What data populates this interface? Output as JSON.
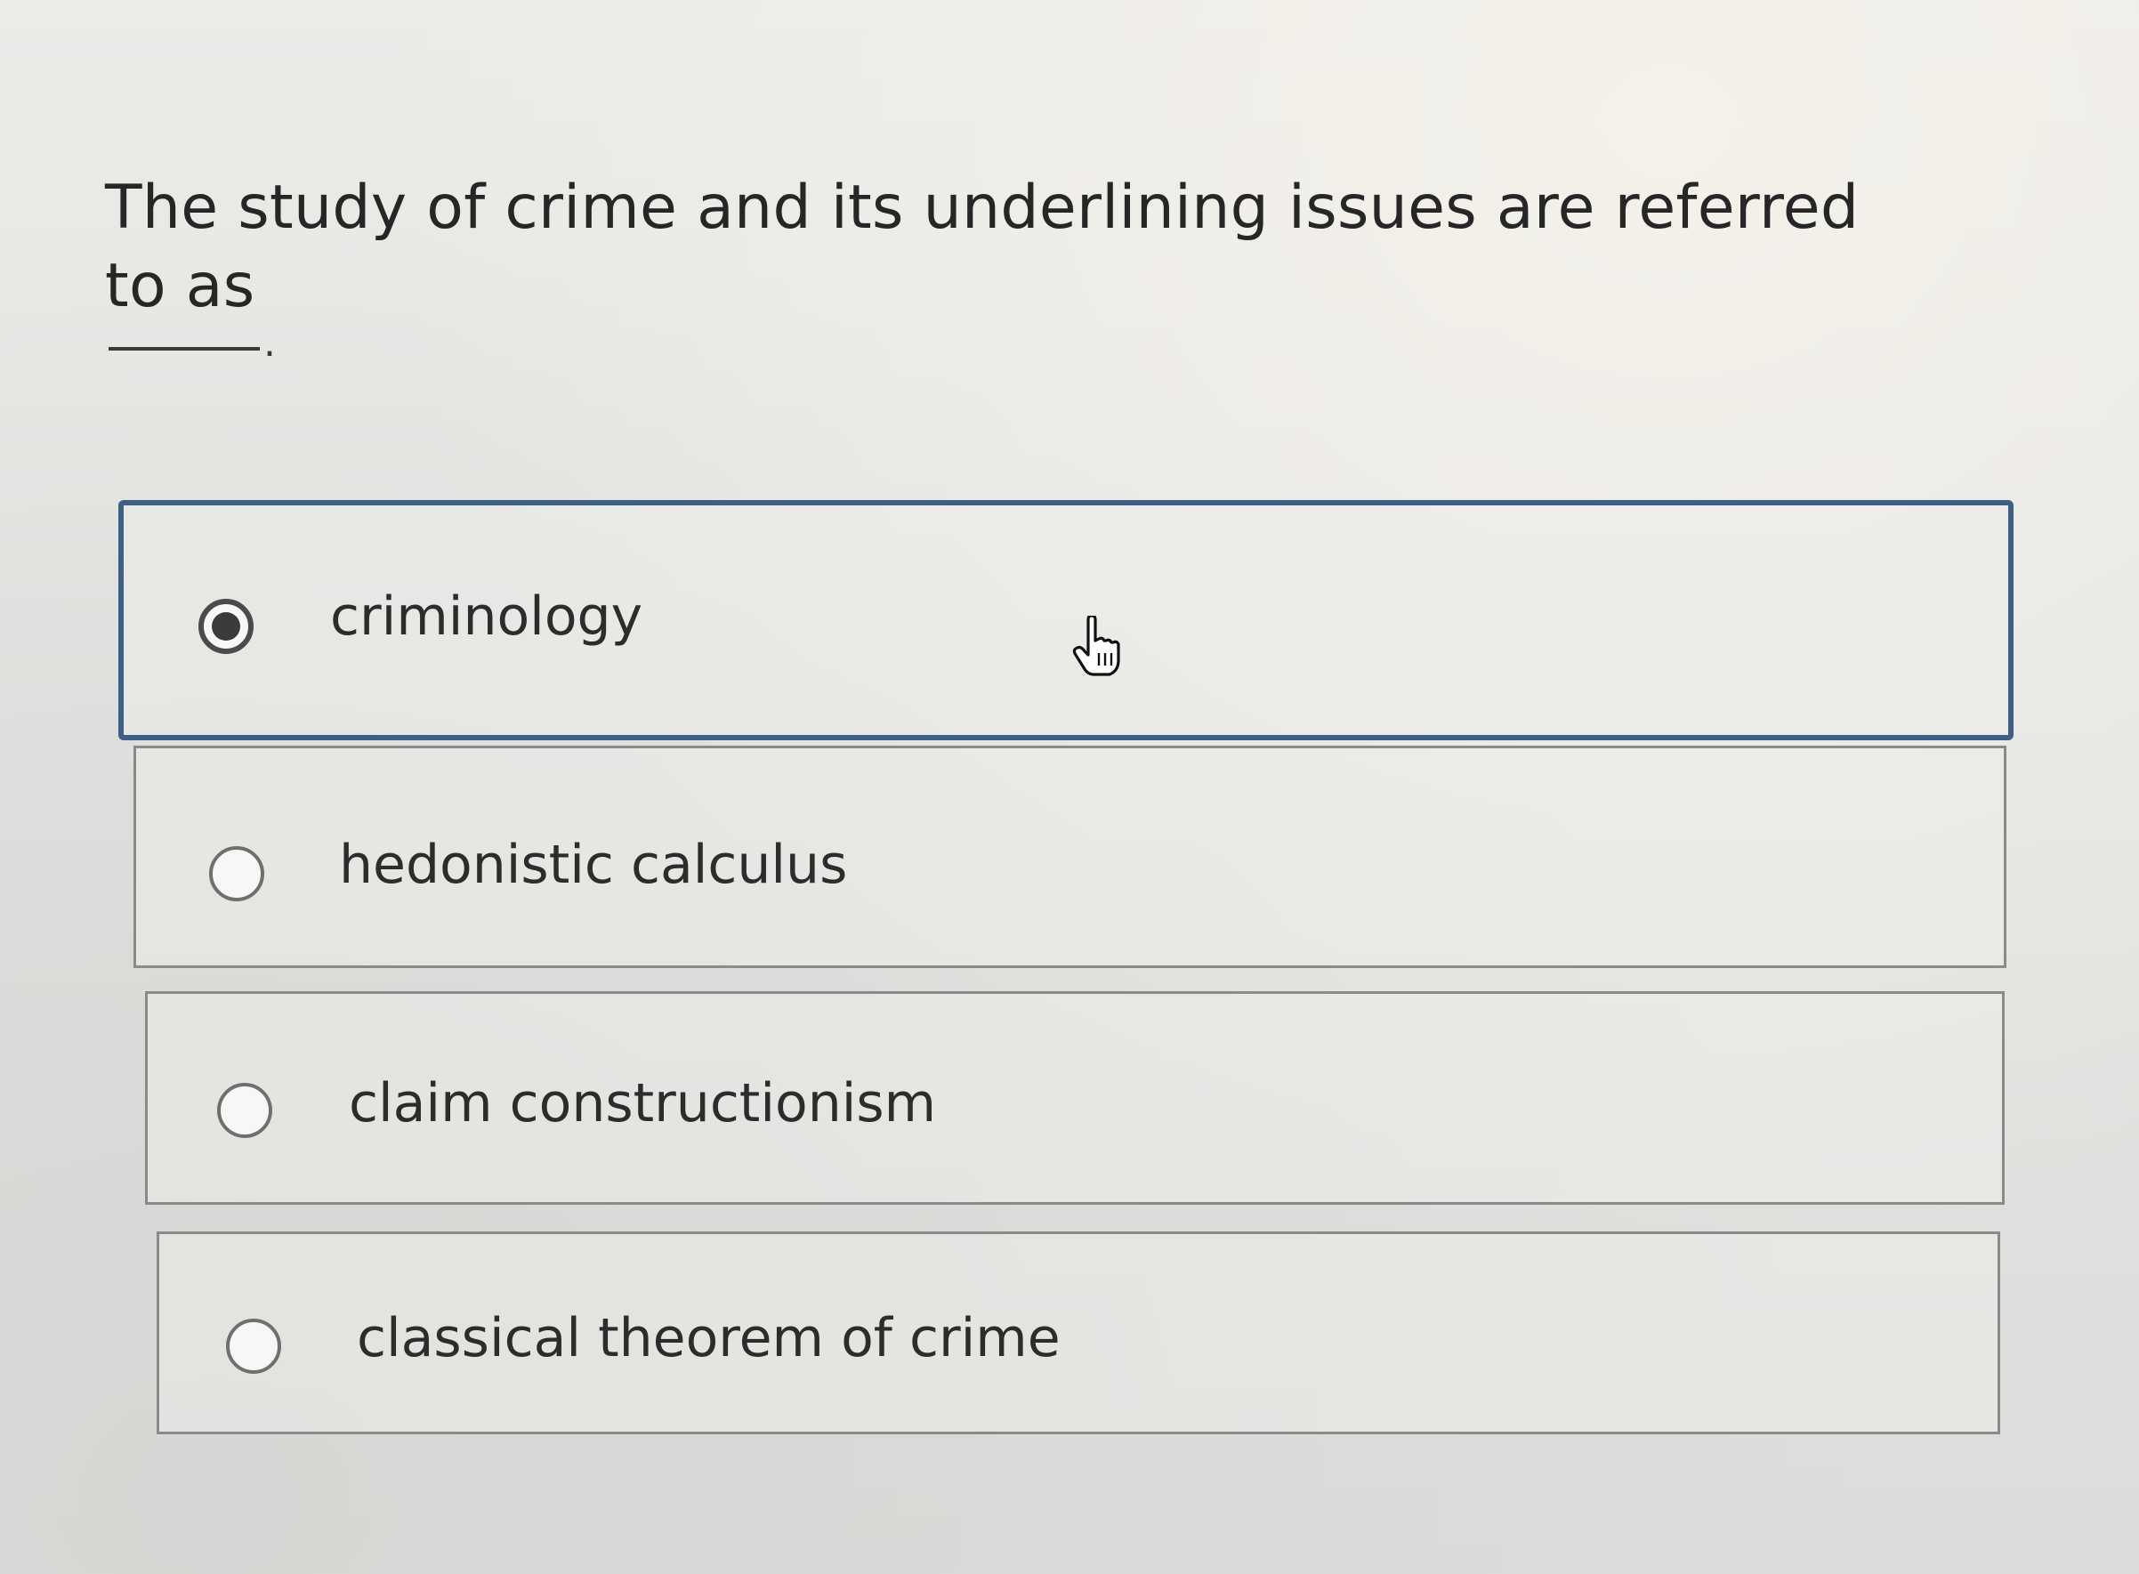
{
  "question": {
    "text": "The study of crime and its underlining issues are referred to as",
    "blank_suffix": "."
  },
  "options": [
    {
      "label": "criminology",
      "selected": true
    },
    {
      "label": "hedonistic calculus",
      "selected": false
    },
    {
      "label": "claim constructionism",
      "selected": false
    },
    {
      "label": "classical theorem of crime",
      "selected": false
    }
  ],
  "colors": {
    "selected_border": "#3e5f86",
    "option_border": "#8a8a8a",
    "text": "#262626"
  },
  "icons": {
    "cursor": "hand-pointer-icon",
    "radio_checked": "radio-checked-icon",
    "radio_unchecked": "radio-unchecked-icon"
  }
}
